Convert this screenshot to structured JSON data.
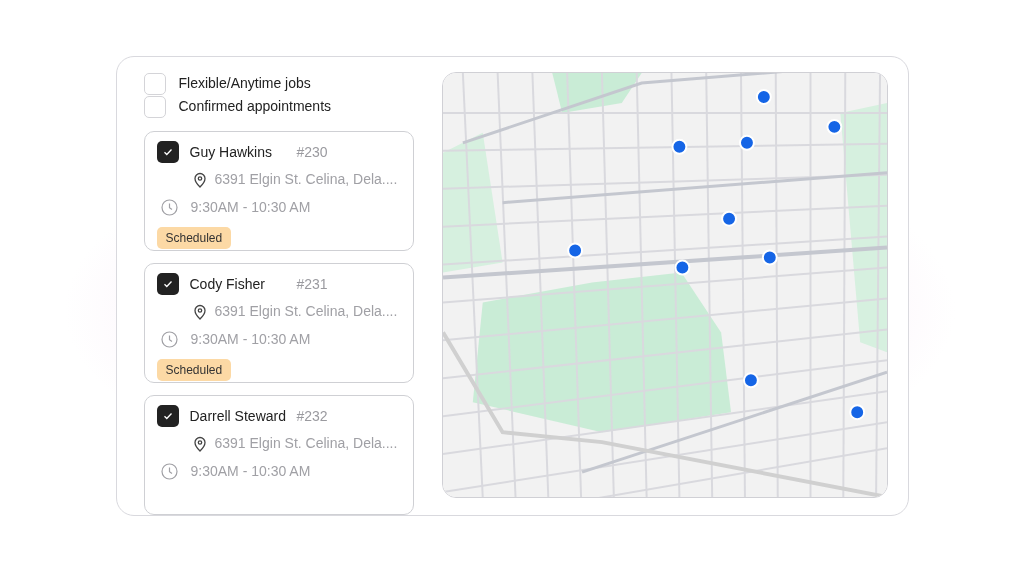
{
  "filters": [
    {
      "label": "Flexible/Anytime jobs",
      "checked": false
    },
    {
      "label": "Confirmed appointments",
      "checked": false
    }
  ],
  "jobs": [
    {
      "name": "Guy Hawkins",
      "number": "#230",
      "address": "6391 Elgin St. Celina, Dela....",
      "time": "9:30AM - 10:30 AM",
      "status": "Scheduled",
      "checked": true
    },
    {
      "name": "Cody Fisher",
      "number": "#231",
      "address": "6391 Elgin St. Celina, Dela....",
      "time": "9:30AM - 10:30 AM",
      "status": "Scheduled",
      "checked": true
    },
    {
      "name": "Darrell Steward",
      "number": "#232",
      "address": "6391 Elgin St. Celina, Dela....",
      "time": "9:30AM - 10:30 AM",
      "checked": true
    }
  ]
}
